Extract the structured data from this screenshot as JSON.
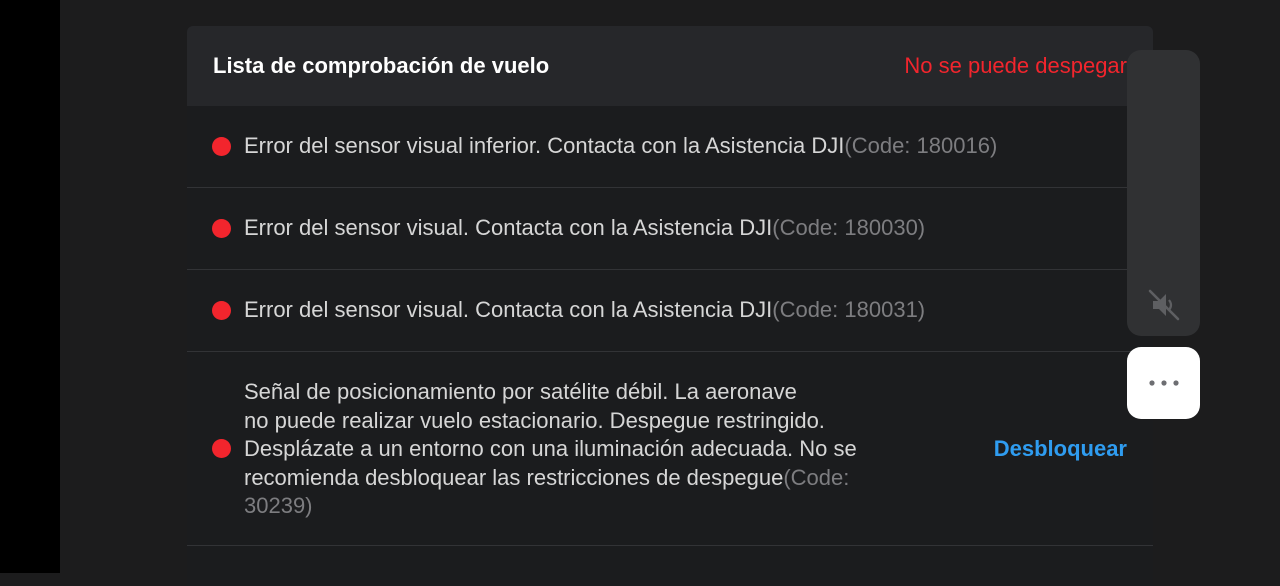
{
  "checklist": {
    "title": "Lista de comprobación de vuelo",
    "status": "No se puede despegar",
    "items": [
      {
        "message": "Error del sensor visual inferior. Contacta con la Asistencia DJI",
        "code": "(Code: 180016)",
        "severity_color": "#f2252d"
      },
      {
        "message": "Error del sensor visual. Contacta con la Asistencia DJI",
        "code": "(Code: 180030)",
        "severity_color": "#f2252d"
      },
      {
        "message": "Error del sensor visual. Contacta con la Asistencia DJI",
        "code": "(Code: 180031)",
        "severity_color": "#f2252d"
      },
      {
        "message_line1": "Señal de posicionamiento por satélite débil. La aeronave",
        "message_line2": "no puede realizar vuelo estacionario. Despegue restringido.",
        "message_line3": "Desplázate a un entorno con una iluminación adecuada. No se",
        "message_line4": "recomienda desbloquear las restricciones de despegue",
        "code": "(Code: 30239)",
        "action_label": "Desbloquear",
        "severity_color": "#f2252d"
      }
    ]
  },
  "side_controls": {
    "mute_icon": "speaker-muted-icon",
    "more_icon": "more-horizontal-icon"
  },
  "colors": {
    "error": "#f2252d",
    "link": "#2f9cf0",
    "background": "#1c1c1d",
    "header": "#26272a"
  }
}
